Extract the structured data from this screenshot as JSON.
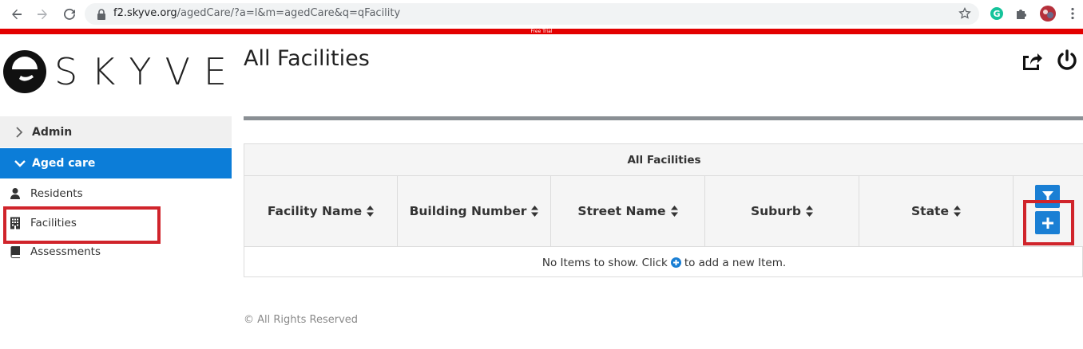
{
  "browser": {
    "url_host": "f2.skyve.org",
    "url_path": "/agedCare/?a=l&m=agedCare&q=qFacility",
    "trial_banner": "Free Trial"
  },
  "brand": {
    "logo_text": "SKYVE",
    "accent": "#0c7dd8",
    "banner_color": "#e30000"
  },
  "sidebar": {
    "groups": [
      {
        "label": "Admin",
        "icon": "chevron-right-icon",
        "expanded": false
      },
      {
        "label": "Aged care",
        "icon": "chevron-down-icon",
        "expanded": true
      }
    ],
    "items": [
      {
        "label": "Residents",
        "icon": "user-icon"
      },
      {
        "label": "Facilities",
        "icon": "building-icon",
        "highlighted": true
      },
      {
        "label": "Assessments",
        "icon": "book-icon"
      }
    ]
  },
  "main": {
    "title": "All Facilities",
    "table": {
      "caption": "All Facilities",
      "columns": [
        "Facility Name",
        "Building Number",
        "Street Name",
        "Suburb",
        "State"
      ],
      "empty_before": "No Items to show. Click",
      "empty_after": "to add a new Item."
    }
  },
  "footer": {
    "text": "© All Rights Reserved"
  }
}
